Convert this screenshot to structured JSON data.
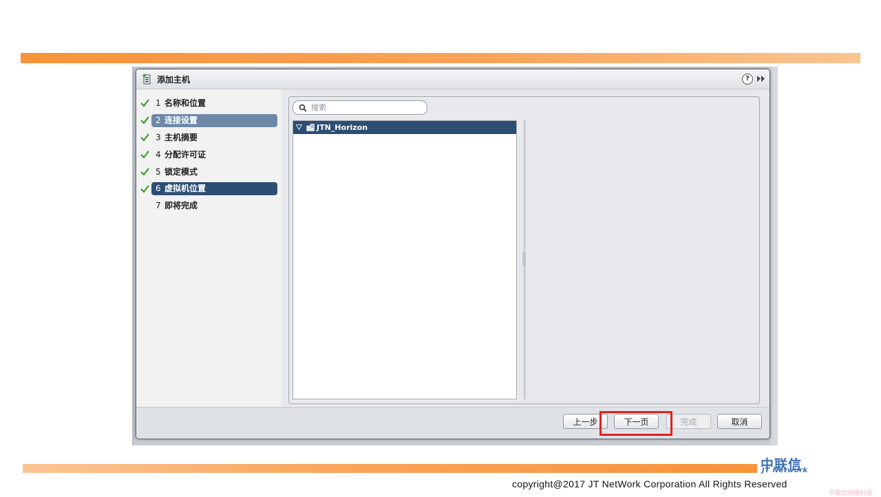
{
  "dialog": {
    "title": "添加主机",
    "help_label": "?"
  },
  "wizard_steps": [
    {
      "num": "1",
      "label": "名称和位置",
      "state": "done"
    },
    {
      "num": "2",
      "label": "连接设置",
      "state": "done-selected"
    },
    {
      "num": "3",
      "label": "主机摘要",
      "state": "done"
    },
    {
      "num": "4",
      "label": "分配许可证",
      "state": "done"
    },
    {
      "num": "5",
      "label": "锁定模式",
      "state": "done"
    },
    {
      "num": "6",
      "label": "虚拟机位置",
      "state": "current"
    },
    {
      "num": "7",
      "label": "即将完成",
      "state": "pending"
    }
  ],
  "search": {
    "placeholder": "搜索"
  },
  "tree": {
    "root_label": "JTN_Horizon"
  },
  "buttons": {
    "back": "上一步",
    "next": "下一页",
    "finish": "完成",
    "cancel": "取消"
  },
  "branding": {
    "logo_cn": "中联信",
    "logo_en": "JT Network",
    "copyright": "copyright@2017  JT NetWork Corporation All Rights Reserved",
    "watermark": "中联信网络科技"
  },
  "colors": {
    "accent_orange": "#f7933a",
    "selection_blue": "#2c4e72",
    "check_green": "#3a9a2a",
    "highlight_red": "#e0201d"
  }
}
